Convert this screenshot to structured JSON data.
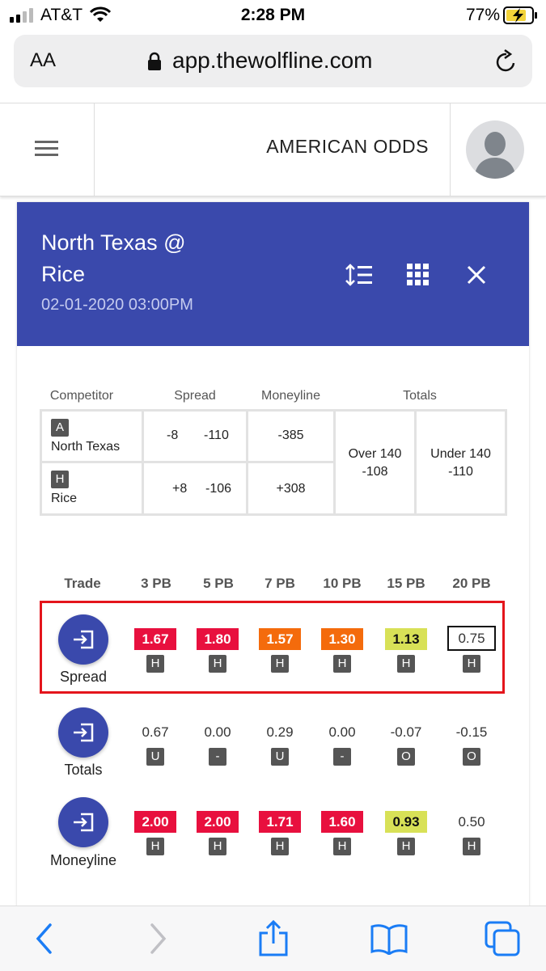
{
  "status_bar": {
    "carrier": "AT&T",
    "time": "2:28 PM",
    "battery": "77%"
  },
  "browser": {
    "text_size": "AA",
    "url": "app.thewolfline.com"
  },
  "app_header": {
    "title": "AMERICAN ODDS"
  },
  "game": {
    "matchup_line1": "North Texas @",
    "matchup_line2": "Rice",
    "datetime": "02-01-2020 03:00PM"
  },
  "odds_table": {
    "headers": {
      "competitor": "Competitor",
      "spread": "Spread",
      "moneyline": "Moneyline",
      "totals": "Totals"
    },
    "rows": [
      {
        "badge": "A",
        "team": "North Texas",
        "spread_line": "-8",
        "spread_price": "-110",
        "moneyline": "-385"
      },
      {
        "badge": "H",
        "team": "Rice",
        "spread_line": "+8",
        "spread_price": "-106",
        "moneyline": "+308"
      }
    ],
    "over": {
      "label": "Over 140",
      "price": "-108"
    },
    "under": {
      "label": "Under 140",
      "price": "-110"
    }
  },
  "trade_grid": {
    "headers": [
      "Trade",
      "3 PB",
      "5 PB",
      "7 PB",
      "10 PB",
      "15 PB",
      "20 PB"
    ],
    "rows": [
      {
        "label": "Spread",
        "cells": [
          {
            "value": "1.67",
            "badge": "H",
            "style": "red"
          },
          {
            "value": "1.80",
            "badge": "H",
            "style": "red"
          },
          {
            "value": "1.57",
            "badge": "H",
            "style": "orange"
          },
          {
            "value": "1.30",
            "badge": "H",
            "style": "orange"
          },
          {
            "value": "1.13",
            "badge": "H",
            "style": "yellow"
          },
          {
            "value": "0.75",
            "badge": "H",
            "style": "boxed"
          }
        ]
      },
      {
        "label": "Totals",
        "cells": [
          {
            "value": "0.67",
            "badge": "U",
            "style": "plain"
          },
          {
            "value": "0.00",
            "badge": "-",
            "style": "plain"
          },
          {
            "value": "0.29",
            "badge": "U",
            "style": "plain"
          },
          {
            "value": "0.00",
            "badge": "-",
            "style": "plain"
          },
          {
            "value": "-0.07",
            "badge": "O",
            "style": "plain"
          },
          {
            "value": "-0.15",
            "badge": "O",
            "style": "plain"
          }
        ]
      },
      {
        "label": "Moneyline",
        "cells": [
          {
            "value": "2.00",
            "badge": "H",
            "style": "red"
          },
          {
            "value": "2.00",
            "badge": "H",
            "style": "red"
          },
          {
            "value": "1.71",
            "badge": "H",
            "style": "red"
          },
          {
            "value": "1.60",
            "badge": "H",
            "style": "red"
          },
          {
            "value": "0.93",
            "badge": "H",
            "style": "yellow"
          },
          {
            "value": "0.50",
            "badge": "H",
            "style": "plain"
          }
        ]
      }
    ]
  },
  "colors": {
    "banner": "#3a49ac",
    "red": "#e8103e",
    "orange": "#f46b0c",
    "yellow": "#d8e157",
    "highlight_border": "#e4151c",
    "ios_blue": "#1a7cf5"
  },
  "icons": [
    "signal-icon",
    "wifi-icon",
    "battery-charging-icon",
    "lock-icon",
    "reload-icon",
    "hamburger-menu-icon",
    "avatar-icon",
    "sort-icon",
    "grid-icon",
    "close-icon",
    "trade-enter-icon",
    "back-icon",
    "forward-icon",
    "share-icon",
    "bookmarks-icon",
    "tabs-icon"
  ]
}
